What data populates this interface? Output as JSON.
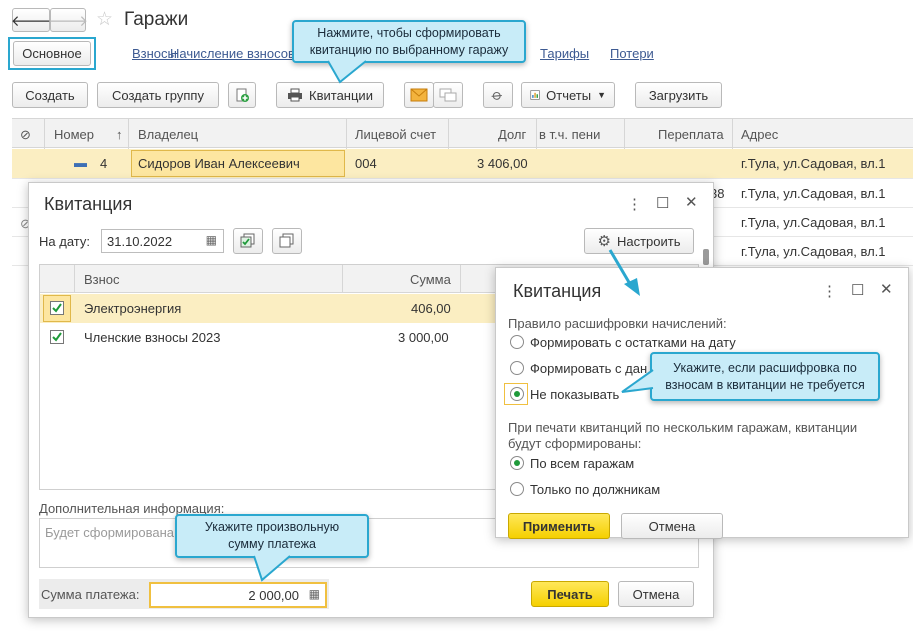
{
  "header": {
    "title": "Гаражи"
  },
  "tabs": [
    "Основное",
    "Взносы",
    "Начисление взносов",
    "Тарифы",
    "Потери"
  ],
  "toolbar": {
    "create": "Создать",
    "create_group": "Создать группу",
    "receipts": "Квитанции",
    "reports": "Отчеты",
    "load": "Загрузить"
  },
  "grid": {
    "columns": [
      "Номер",
      "Владелец",
      "Лицевой счет",
      "Долг",
      "в т.ч. пени",
      "Переплата",
      "Адрес"
    ],
    "rows": [
      {
        "number": "4",
        "owner": "Сидоров Иван Алексеевич",
        "account": "004",
        "debt": "3 406,00",
        "address": "г.Тула, ул.Садовая, вл.1"
      },
      {
        "tail": "38",
        "address": "г.Тула, ул.Садовая, вл.1"
      },
      {
        "address": "г.Тула, ул.Садовая, вл.1"
      },
      {
        "address": "г.Тула, ул.Садовая, вл.1"
      }
    ]
  },
  "receipt": {
    "title": "Квитанция",
    "date_label": "На дату:",
    "date_value": "31.10.2022",
    "configure": "Настроить",
    "table_headers": [
      "Взнос",
      "Сумма"
    ],
    "items": [
      {
        "name": "Электроэнергия",
        "sum": "406,00"
      },
      {
        "name": "Членские взносы 2023",
        "sum": "3 000,00"
      }
    ],
    "info_label": "Дополнительная информация:",
    "info_placeholder": "Будет сформирована",
    "amount_label": "Сумма платежа:",
    "amount_value": "2 000,00",
    "print": "Печать",
    "cancel": "Отмена"
  },
  "settings": {
    "title": "Квитанция",
    "rule_label": "Правило расшифровки начислений:",
    "options": [
      "Формировать с остатками на дату",
      "Формировать с дан",
      "Не показывать"
    ],
    "print_label_1": "При печати квитанций по нескольким гаражам, квитанции",
    "print_label_2": "будут сформированы:",
    "print_options": [
      "По всем гаражам",
      "Только по должникам"
    ],
    "apply": "Применить",
    "cancel": "Отмена"
  },
  "tooltips": {
    "receipts_1": "Нажмите, чтобы сформировать",
    "receipts_2": "квитанцию по выбранному гаражу",
    "decode_1": "Укажите, если расшифровка по",
    "decode_2": "взносам в квитанции не требуется",
    "amount_1": "Укажите произвольную",
    "amount_2": "сумму платежа"
  },
  "colors": {
    "accent_yellow": "#f5d000",
    "selection": "#fbeec2",
    "tooltip_border": "#2aa7cf",
    "checkbox": "#1f9a3a"
  }
}
